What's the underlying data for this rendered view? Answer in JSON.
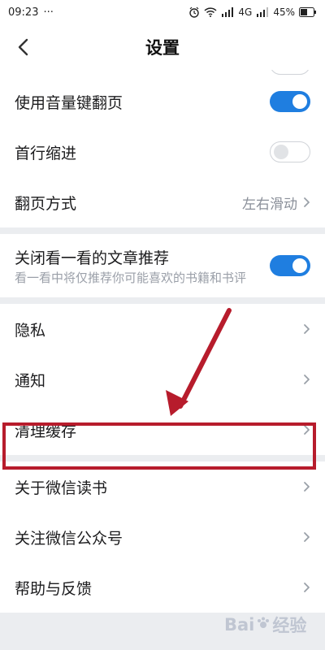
{
  "status_bar": {
    "time": "09:23",
    "dots": "···",
    "signal_label": "4G",
    "battery": "45%",
    "icons": [
      "alarm-icon",
      "wifi-icon",
      "signal-icon",
      "battery-icon"
    ]
  },
  "nav": {
    "title": "设置",
    "back_icon": "chevron-left-icon"
  },
  "groups": {
    "reading": {
      "volume_page_turn": {
        "label": "使用音量键翻页",
        "toggle_on": true
      },
      "first_line_indent": {
        "label": "首行缩进",
        "toggle_on": false
      },
      "page_turn_mode": {
        "label": "翻页方式",
        "value": "左右滑动"
      }
    },
    "recommend": {
      "close_recommend": {
        "label": "关闭看一看的文章推荐",
        "sub": "看一看中将仅推荐你可能喜欢的书籍和书评",
        "toggle_on": true
      }
    },
    "privacy": {
      "privacy": {
        "label": "隐私"
      },
      "notification": {
        "label": "通知"
      },
      "clear_cache": {
        "label": "清理缓存"
      }
    },
    "about": {
      "about_wechat_read": {
        "label": "关于微信读书"
      },
      "follow_official": {
        "label": "关注微信公众号"
      },
      "help_feedback": {
        "label": "帮助与反馈"
      }
    }
  },
  "colors": {
    "accent": "#1f7ee0",
    "highlight": "#b71c2c",
    "background": "#ebedf0"
  },
  "watermark": {
    "brand": "Bai",
    "brand2": "经验",
    "sub": "jingyan.baidu.com"
  }
}
